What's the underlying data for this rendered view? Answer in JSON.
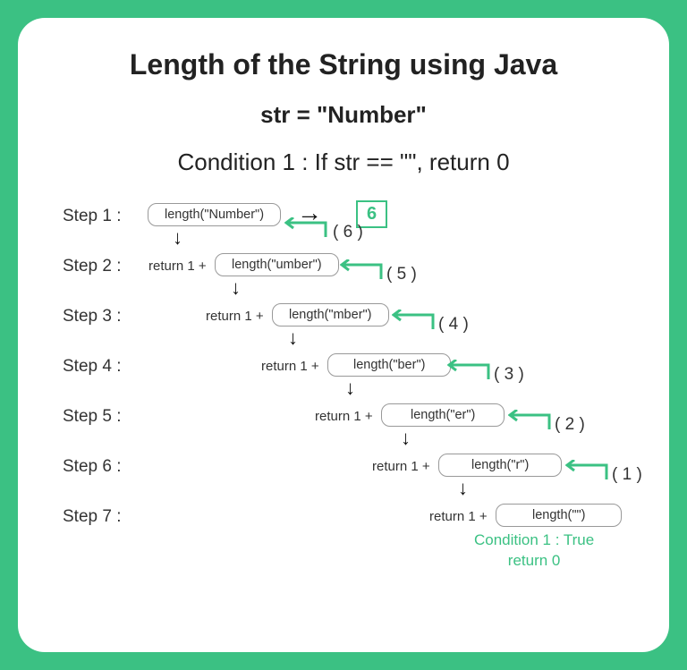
{
  "title": "Length of the String using Java",
  "subtitle": "str = \"Number\"",
  "condition": "Condition 1 : If str == \"\", return 0",
  "result_value": "6",
  "right_arrow_glyph": "→",
  "down_arrow_glyph": "↓",
  "steps": [
    {
      "label": "Step 1 :",
      "prefix": "",
      "call": "length(\"Number\")",
      "return_val": "( 6 )"
    },
    {
      "label": "Step 2 :",
      "prefix": "return 1 +",
      "call": "length(\"umber\")",
      "return_val": "( 5 )"
    },
    {
      "label": "Step 3 :",
      "prefix": "return 1 +",
      "call": "length(\"mber\")",
      "return_val": "( 4 )"
    },
    {
      "label": "Step 4 :",
      "prefix": "return 1 +",
      "call": "length(\"ber\")",
      "return_val": "( 3 )"
    },
    {
      "label": "Step 5 :",
      "prefix": "return 1 +",
      "call": "length(\"er\")",
      "return_val": "( 2 )"
    },
    {
      "label": "Step 6 :",
      "prefix": "return 1 +",
      "call": "length(\"r\")",
      "return_val": "( 1 )"
    },
    {
      "label": "Step 7 :",
      "prefix": "return 1 +",
      "call": "length(\"\")",
      "return_val": ""
    }
  ],
  "base_case": {
    "line1": "Condition 1 : True",
    "line2": "return 0"
  },
  "colors": {
    "accent": "#3bc183",
    "text": "#222",
    "border": "#999"
  }
}
